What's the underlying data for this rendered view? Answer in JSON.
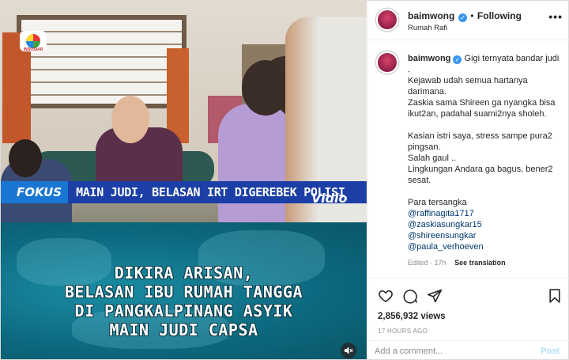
{
  "media": {
    "ticker_brand": "FOKUS",
    "ticker_text": "MAIN JUDI, BELASAN IRT DIGEREBEK POLISI",
    "watermark": "Vidio",
    "station_tag": "INDOSIAR",
    "caption_lines": [
      "DIKIRA ARISAN,",
      "BELASAN IBU RUMAH TANGGA",
      "DI PANGKALPINANG ASYIK",
      "MAIN JUDI CAPSA"
    ]
  },
  "header": {
    "username": "baimwong",
    "separator": "•",
    "follow_label": "Following",
    "location": "Rumah Rafi",
    "more": "•••"
  },
  "caption": {
    "username": "baimwong",
    "lines_1": [
      "Gigi ternyata bandar judi .",
      "Kejawab udah semua hartanya darimana.",
      "Zaskia sama Shireen ga nyangka bisa ikut2an, padahal suami2nya sholeh."
    ],
    "lines_2": [
      "Kasian istri saya, stress sampe pura2 pingsan.",
      "Salah gaul ..",
      "Lingkungan Andara ga bagus, bener2 sesat."
    ],
    "tersangka_label": "Para tersangka",
    "mentions": [
      "@raffinagita1717",
      "@zaskiasungkar15",
      "@shireensungkar",
      "@paula_verhoeven"
    ],
    "edited": "Edited · 17h",
    "see_translation": "See translation"
  },
  "footer": {
    "views": "2,856,932 views",
    "time": "17 HOURS AGO",
    "comment_placeholder": "Add a comment...",
    "post_label": "Post"
  },
  "colors": {
    "link": "#00376b",
    "verified": "#3897f0",
    "post_disabled": "#b2dffc",
    "caption_bg": "#0d6a80",
    "ticker_bg": "#1b3fa6"
  }
}
